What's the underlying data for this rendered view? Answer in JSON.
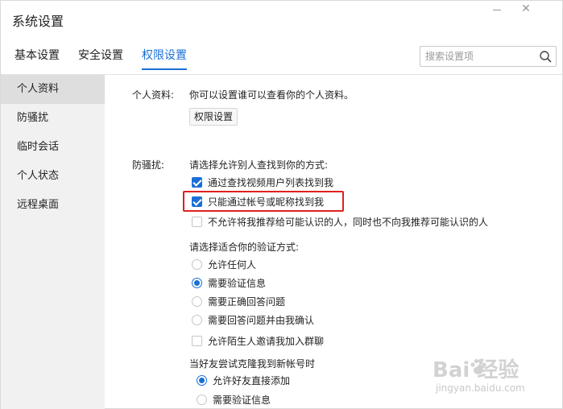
{
  "window": {
    "title": "系统设置"
  },
  "tabs": [
    {
      "label": "基本设置"
    },
    {
      "label": "安全设置"
    },
    {
      "label": "权限设置"
    }
  ],
  "search": {
    "placeholder": "搜索设置项",
    "value": ""
  },
  "sidebar": {
    "items": [
      {
        "label": "个人资料"
      },
      {
        "label": "防骚扰"
      },
      {
        "label": "临时会话"
      },
      {
        "label": "个人状态"
      },
      {
        "label": "远程桌面"
      }
    ]
  },
  "profile": {
    "label": "个人资料:",
    "description": "你可以设置谁可以查看你的个人资料。",
    "button_label": "权限设置"
  },
  "anti_harass": {
    "label": "防骚扰:",
    "find_prompt": "请选择允许别人查找到你的方式:",
    "find_options": [
      {
        "label": "通过查找视频用户列表找到我",
        "checked": true
      },
      {
        "label": "只能通过帐号或昵称找到我",
        "checked": true
      },
      {
        "label": "不允许将我推荐给可能认识的人，同时也不向我推荐可能认识的人",
        "checked": false
      }
    ],
    "verify_prompt": "请选择适合你的验证方式:",
    "verify_options": [
      {
        "label": "允许任何人",
        "selected": false
      },
      {
        "label": "需要验证信息",
        "selected": true
      },
      {
        "label": "需要正确回答问题",
        "selected": false
      },
      {
        "label": "需要回答问题并由我确认",
        "selected": false
      }
    ],
    "group_invite": {
      "label": "允许陌生人邀请我加入群聊",
      "checked": false
    },
    "clone_prompt": "当好友尝试克隆我到新帐号时",
    "clone_options": [
      {
        "label": "允许好友直接添加",
        "selected": true
      },
      {
        "label": "需要验证信息",
        "selected": false
      }
    ]
  },
  "colors": {
    "accent": "#1a6fd6",
    "highlight": "#e02020"
  },
  "watermark": {
    "logo": "Bai  经验",
    "site": "jingyan.baidu.com"
  }
}
